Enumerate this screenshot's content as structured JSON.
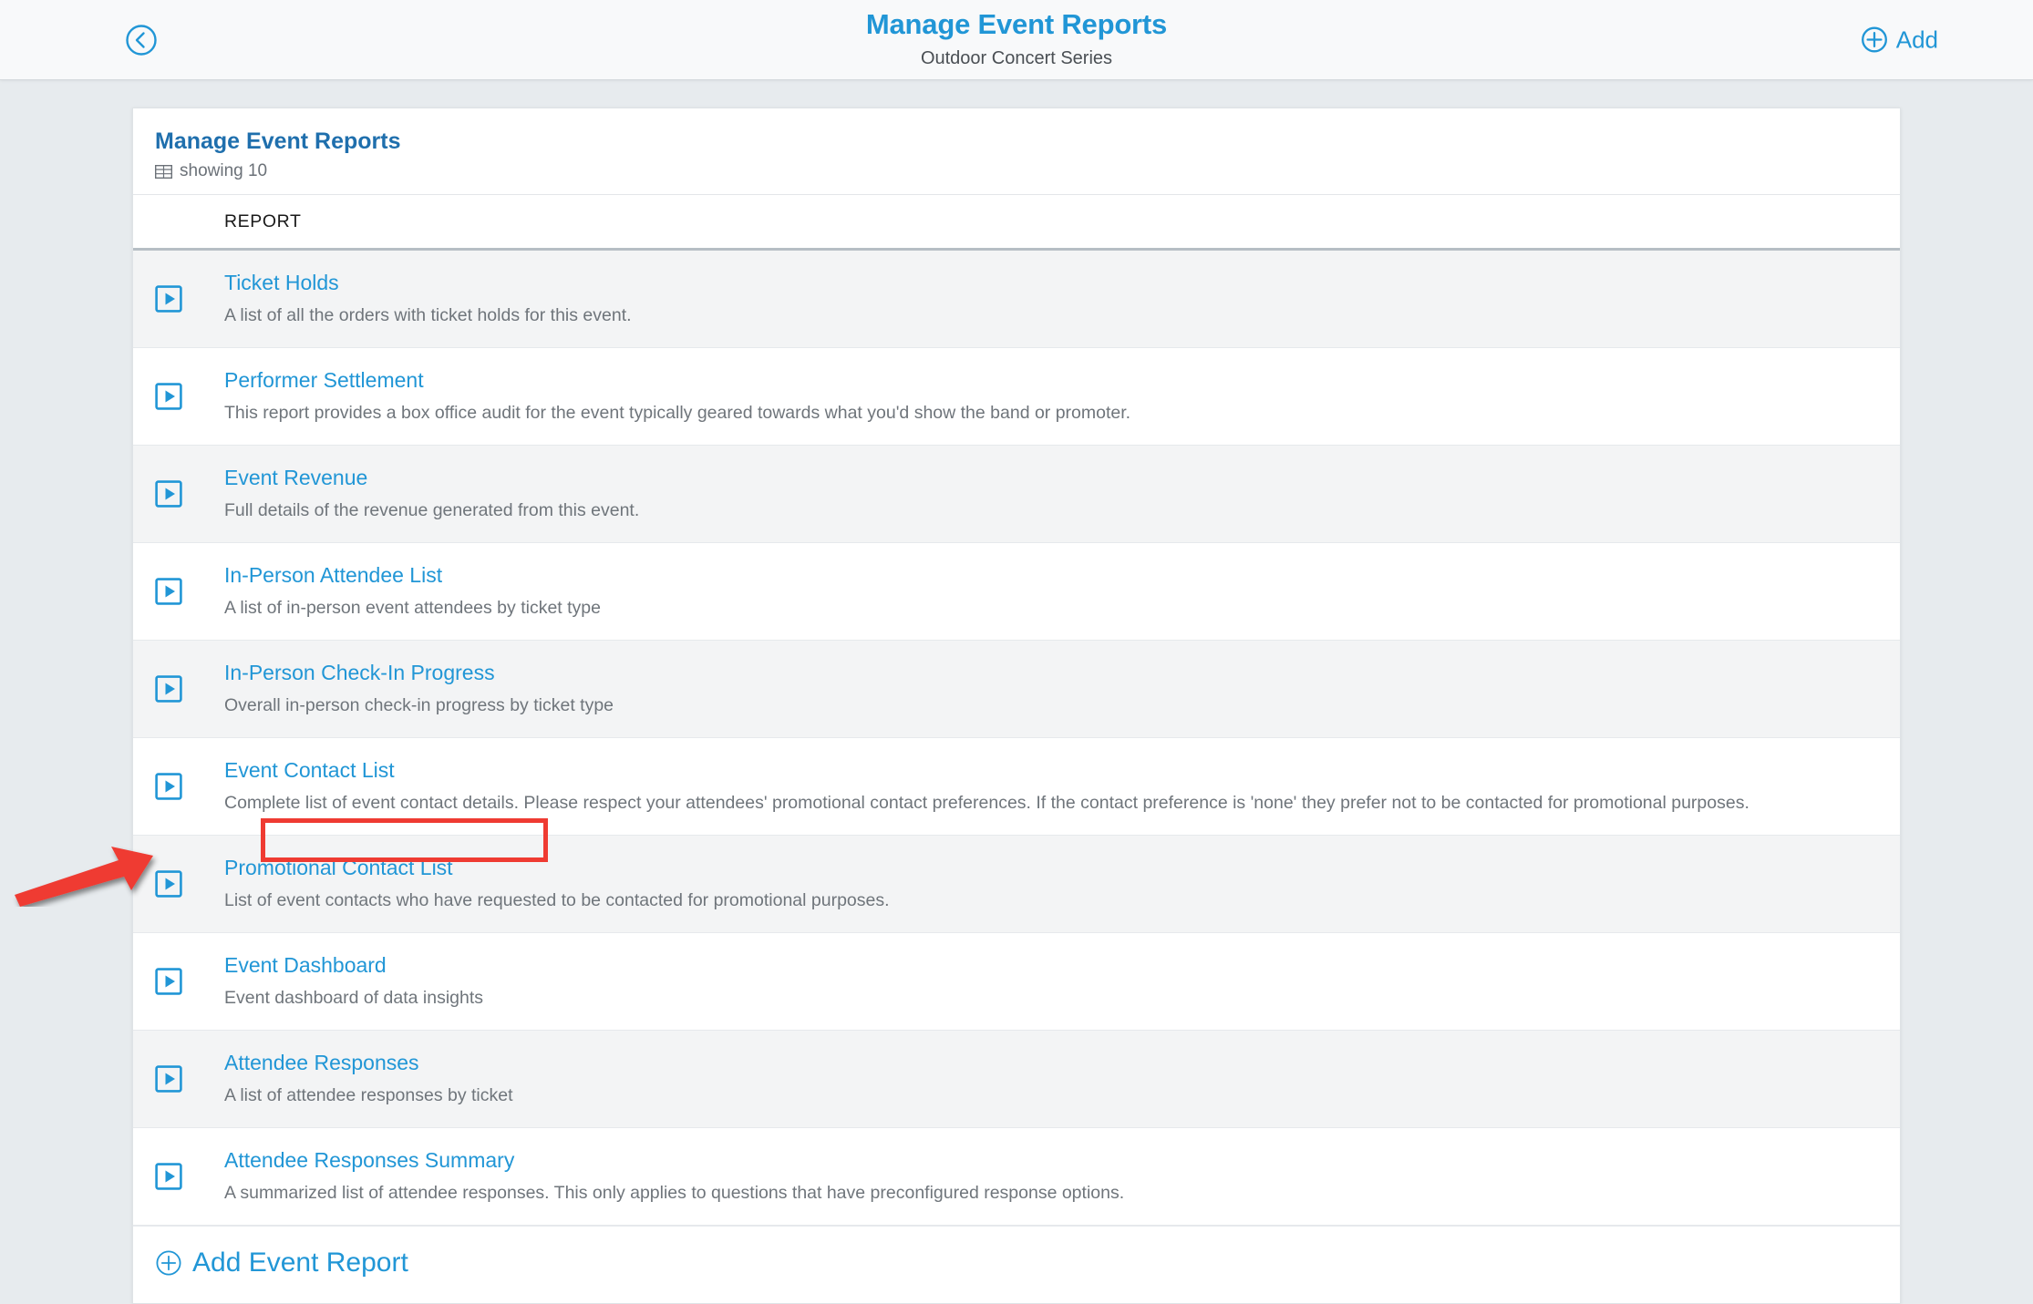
{
  "topbar": {
    "back_icon": "chevron-left-circle-icon",
    "title": "Manage Event Reports",
    "subtitle": "Outdoor Concert Series",
    "add_icon": "plus-circle-icon",
    "add_label": "Add"
  },
  "card": {
    "title": "Manage Event Reports",
    "count_icon": "table-grid-icon",
    "count_label": "showing 10",
    "column_headers": {
      "run": "",
      "report": "REPORT"
    },
    "rows": [
      {
        "run_icon": "run-report-icon",
        "title": "Ticket Holds",
        "description": "A list of all the orders with ticket holds for this event."
      },
      {
        "run_icon": "run-report-icon",
        "title": "Performer Settlement",
        "description": "This report provides a box office audit for the event typically geared towards what you'd show the band or promoter."
      },
      {
        "run_icon": "run-report-icon",
        "title": "Event Revenue",
        "description": "Full details of the revenue generated from this event."
      },
      {
        "run_icon": "run-report-icon",
        "title": "In-Person Attendee List",
        "description": "A list of in-person event attendees by ticket type"
      },
      {
        "run_icon": "run-report-icon",
        "title": "In-Person Check-In Progress",
        "description": "Overall in-person check-in progress by ticket type"
      },
      {
        "run_icon": "run-report-icon",
        "title": "Event Contact List",
        "description": "Complete list of event contact details. Please respect your attendees' promotional contact preferences. If the contact preference is 'none' they prefer not to be contacted for promotional purposes."
      },
      {
        "run_icon": "run-report-icon",
        "title": "Promotional Contact List",
        "description": "List of event contacts who have requested to be contacted for promotional purposes."
      },
      {
        "run_icon": "run-report-icon",
        "title": "Event Dashboard",
        "description": "Event dashboard of data insights"
      },
      {
        "run_icon": "run-report-icon",
        "title": "Attendee Responses",
        "description": "A list of attendee responses by ticket"
      },
      {
        "run_icon": "run-report-icon",
        "title": "Attendee Responses Summary",
        "description": "A summarized list of attendee responses. This only applies to questions that have preconfigured response options."
      }
    ],
    "footer": {
      "add_icon": "plus-circle-icon",
      "add_label": "Add Event Report"
    }
  },
  "annotations": {
    "highlight_target": "Promotional Contact List",
    "arrow_target": "run-report-icon",
    "color": "#ef3b32"
  },
  "colors": {
    "accent_blue": "#2196d6",
    "title_blue": "#1f6fad",
    "page_background": "#e7ebee",
    "row_alt": "#f3f4f5",
    "text_muted": "#6f757b"
  }
}
